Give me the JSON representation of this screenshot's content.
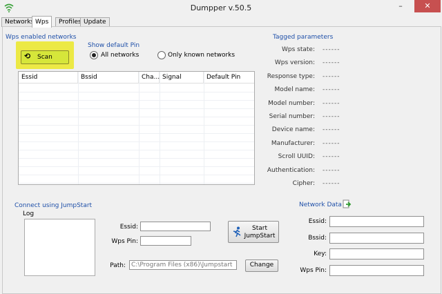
{
  "window": {
    "title": "Dumpper v.50.5",
    "minimize": "–",
    "maximize": "□",
    "close": "✕"
  },
  "tabs": [
    "Networks",
    "Wps",
    "Profiles",
    "Update"
  ],
  "wps_networks": {
    "group_label": "Wps enabled networks",
    "scan_label": "Scan",
    "show_pin_label": "Show default Pin",
    "radio_all": "All networks",
    "radio_known": "Only known networks",
    "selected_radio": "All networks",
    "columns": [
      "Essid",
      "Bssid",
      "Cha...",
      "Signal",
      "Default Pin"
    ]
  },
  "tagged": {
    "title": "Tagged parameters",
    "params": [
      {
        "label": "Wps state:",
        "value": "------"
      },
      {
        "label": "Wps version:",
        "value": "------"
      },
      {
        "label": "Response type:",
        "value": "------"
      },
      {
        "label": "Model name:",
        "value": "------"
      },
      {
        "label": "Model number:",
        "value": "------"
      },
      {
        "label": "Serial number:",
        "value": "------"
      },
      {
        "label": "Device name:",
        "value": "------"
      },
      {
        "label": "Manufacturer:",
        "value": "------"
      },
      {
        "label": "Scroll UUID:",
        "value": "------"
      },
      {
        "label": "Authentication:",
        "value": "------"
      },
      {
        "label": "Cipher:",
        "value": "------"
      }
    ]
  },
  "jumpstart": {
    "group_label": "Connect using JumpStart",
    "log_label": "Log",
    "essid_label": "Essid:",
    "essid_value": "",
    "pin_label": "Wps Pin:",
    "pin_value": "",
    "start_line1": "Start",
    "start_line2": "JumpStart",
    "path_label": "Path:",
    "path_value": "C:\\Program Files (x86)\\Jumpstart",
    "change_label": "Change"
  },
  "network_data": {
    "title": "Network Data",
    "fields": [
      {
        "label": "Essid:",
        "value": ""
      },
      {
        "label": "Bssid:",
        "value": ""
      },
      {
        "label": "Key:",
        "value": ""
      },
      {
        "label": "Wps Pin:",
        "value": ""
      }
    ]
  }
}
